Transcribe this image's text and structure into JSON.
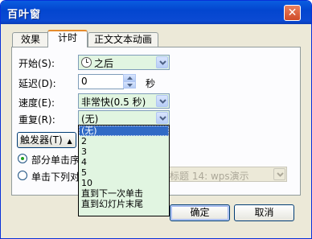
{
  "window": {
    "title": "百叶窗",
    "close_glyph": "✕"
  },
  "tabs": [
    {
      "label": "效果",
      "active": false
    },
    {
      "label": "计时",
      "active": true
    },
    {
      "label": "正文文本动画",
      "active": false
    }
  ],
  "form": {
    "start_label": "开始(S):",
    "start_value": "之后",
    "delay_label": "延迟(D):",
    "delay_value": "0",
    "delay_unit": "秒",
    "speed_label": "速度(E):",
    "speed_value": "非常快(0.5 秒)",
    "repeat_label": "重复(R):",
    "repeat_value": "(无)"
  },
  "triggers": {
    "button_label": "触发器(T)",
    "toggle_glyph": "▲",
    "option1_label": "部分单击序",
    "option2_label": "单击下列对",
    "option1_selected": true,
    "shape_value": "标题 14: wps演示"
  },
  "repeat_options": {
    "items": [
      "(无)",
      "2",
      "3",
      "4",
      "5",
      "10",
      "直到下一次单击",
      "直到幻灯片末尾"
    ],
    "selected_index": 0
  },
  "buttons": {
    "ok": "确定",
    "cancel": "取消"
  },
  "colors": {
    "titlebar": "#0a5de0",
    "dialog_bg": "#ece9d8",
    "list_bg": "#e1f5e1",
    "selection": "#316ac5",
    "combo_green": "#e1f5e1"
  }
}
